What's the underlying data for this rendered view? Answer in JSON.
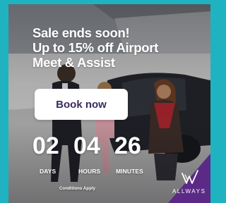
{
  "ad": {
    "headline_lines": [
      "Sale ends soon!",
      "Up to 15% off Airport",
      "Meet & Assist"
    ],
    "cta_label": "Book now",
    "countdown": [
      {
        "value": "02",
        "unit": "DAYS"
      },
      {
        "value": "04",
        "unit": "HOURS"
      },
      {
        "value": "26",
        "unit": "MINUTES"
      }
    ],
    "conditions": "Conditions Apply",
    "brand": "ALLWAYS"
  },
  "colors": {
    "frame": "#1fb3c1",
    "brand_corner": "#5a2a86",
    "cta_text": "#3a2b5c",
    "text": "#ffffff"
  },
  "icons": [
    "allways-logo-icon"
  ]
}
